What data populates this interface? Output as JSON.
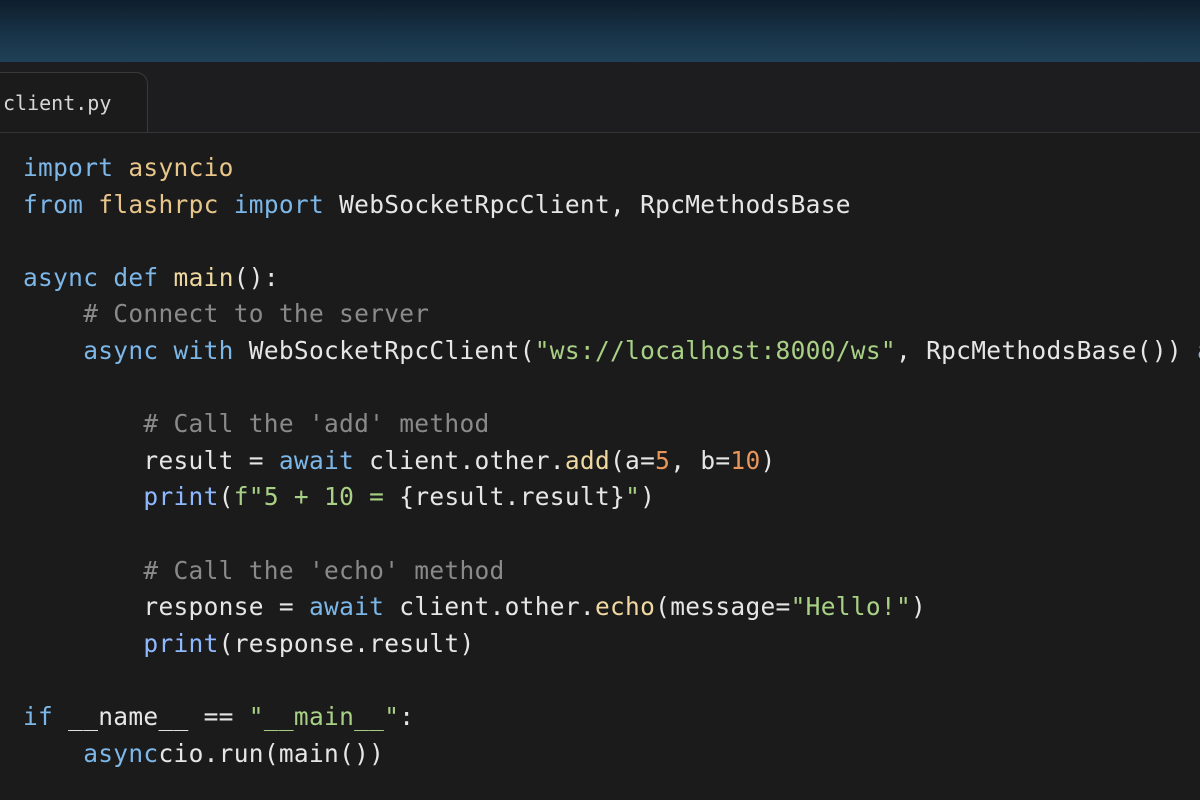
{
  "tab": {
    "filename": "client.py"
  },
  "code": [
    [
      {
        "t": "import",
        "c": "kw"
      },
      {
        "t": " ",
        "c": "tx"
      },
      {
        "t": "asyncio",
        "c": "mod"
      }
    ],
    [
      {
        "t": "from",
        "c": "kw"
      },
      {
        "t": " ",
        "c": "tx"
      },
      {
        "t": "flashrpc",
        "c": "mod"
      },
      {
        "t": " ",
        "c": "tx"
      },
      {
        "t": "import",
        "c": "kw"
      },
      {
        "t": " WebSocketRpcClient, RpcMethodsBase",
        "c": "tx"
      }
    ],
    [],
    [
      {
        "t": "async",
        "c": "kw"
      },
      {
        "t": " ",
        "c": "tx"
      },
      {
        "t": "def",
        "c": "kw"
      },
      {
        "t": " ",
        "c": "tx"
      },
      {
        "t": "main",
        "c": "fn"
      },
      {
        "t": "():",
        "c": "tx"
      }
    ],
    [
      {
        "t": "    # Connect to the server",
        "c": "cm"
      }
    ],
    [
      {
        "t": "    ",
        "c": "tx"
      },
      {
        "t": "async",
        "c": "kw"
      },
      {
        "t": " ",
        "c": "tx"
      },
      {
        "t": "with",
        "c": "kw"
      },
      {
        "t": " WebSocketRpcClient(",
        "c": "tx"
      },
      {
        "t": "\"ws://localhost:8000/ws\"",
        "c": "str"
      },
      {
        "t": ", RpcMethodsBase()) ",
        "c": "tx"
      },
      {
        "t": "as",
        "c": "kw"
      }
    ],
    [],
    [
      {
        "t": "        # Call the 'add' method",
        "c": "cm"
      }
    ],
    [
      {
        "t": "        result = ",
        "c": "tx"
      },
      {
        "t": "await",
        "c": "kw"
      },
      {
        "t": " client.other.",
        "c": "tx"
      },
      {
        "t": "add",
        "c": "fn"
      },
      {
        "t": "(a=",
        "c": "tx"
      },
      {
        "t": "5",
        "c": "num"
      },
      {
        "t": ", b=",
        "c": "tx"
      },
      {
        "t": "10",
        "c": "num"
      },
      {
        "t": ")",
        "c": "tx"
      }
    ],
    [
      {
        "t": "        ",
        "c": "tx"
      },
      {
        "t": "print",
        "c": "bi"
      },
      {
        "t": "(",
        "c": "tx"
      },
      {
        "t": "f\"5 + 10 = ",
        "c": "str"
      },
      {
        "t": "{result.result}",
        "c": "tx"
      },
      {
        "t": "\"",
        "c": "str"
      },
      {
        "t": ")",
        "c": "tx"
      }
    ],
    [],
    [
      {
        "t": "        # Call the 'echo' method",
        "c": "cm"
      }
    ],
    [
      {
        "t": "        response = ",
        "c": "tx"
      },
      {
        "t": "await",
        "c": "kw"
      },
      {
        "t": " client.other.",
        "c": "tx"
      },
      {
        "t": "echo",
        "c": "fn"
      },
      {
        "t": "(message=",
        "c": "tx"
      },
      {
        "t": "\"Hello!\"",
        "c": "str"
      },
      {
        "t": ")",
        "c": "tx"
      }
    ],
    [
      {
        "t": "        ",
        "c": "tx"
      },
      {
        "t": "print",
        "c": "bi"
      },
      {
        "t": "(response.result)",
        "c": "tx"
      }
    ],
    [],
    [
      {
        "t": "if",
        "c": "kw"
      },
      {
        "t": " __name__ == ",
        "c": "tx"
      },
      {
        "t": "\"__main__\"",
        "c": "str"
      },
      {
        "t": ":",
        "c": "tx"
      }
    ],
    [
      {
        "t": "    ",
        "c": "tx"
      },
      {
        "t": "async",
        "c": "kw"
      },
      {
        "t": "cio.run(main())",
        "c": "tx"
      }
    ]
  ],
  "colors": {
    "background": "#1b1b1c",
    "keyword": "#7cb7e8",
    "module": "#e8c68a",
    "function": "#efd9a0",
    "comment": "#8a8a8a",
    "string": "#a9d185",
    "number": "#e8955a",
    "builtin": "#8fb8ff",
    "text": "#e6e6e6"
  }
}
